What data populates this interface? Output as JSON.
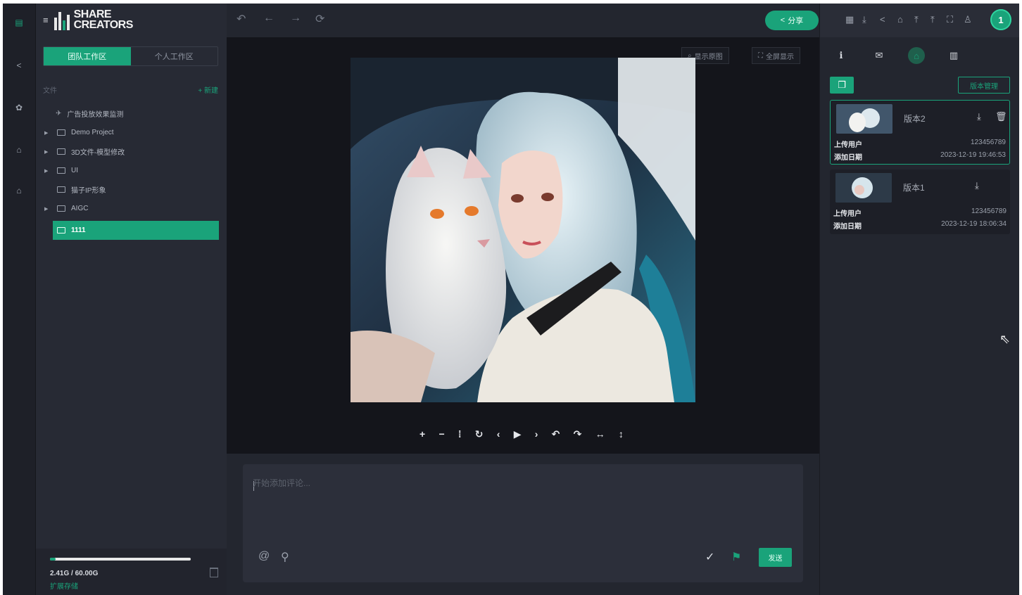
{
  "app": {
    "brand_line1": "SHARE",
    "brand_line2": "CREATORS"
  },
  "workspace_tabs": [
    "团队工作区",
    "个人工作区"
  ],
  "section": {
    "title": "文件",
    "action": "+ 新建"
  },
  "tree": [
    {
      "label": "广告投放效果监测",
      "expandable": false,
      "pinned": true
    },
    {
      "label": "Demo Project",
      "expandable": true
    },
    {
      "label": "3D文件-模型修改",
      "expandable": true
    },
    {
      "label": "UI",
      "expandable": true
    },
    {
      "label": "猫子IP形象",
      "expandable": false
    },
    {
      "label": "AIGC",
      "expandable": true
    },
    {
      "label": "1111",
      "expandable": false,
      "selected": true
    }
  ],
  "storage": {
    "text": "2.41G / 60.00G",
    "link": "扩展存储",
    "used_fraction": 0.04
  },
  "toolbar": {
    "share_label": "分享"
  },
  "viewer": {
    "original_label": "显示原图",
    "fullscreen_label": "全屏显示"
  },
  "comment": {
    "placeholder": "开始添加评论...",
    "send_label": "发送"
  },
  "right": {
    "avatar_initial": "1",
    "version_manage_label": "版本管理",
    "versions": [
      {
        "name": "版本2",
        "uploader_label": "上传用户",
        "uploader": "123456789",
        "date_label": "添加日期",
        "date": "2023-12-19 19:46:53",
        "selected": true
      },
      {
        "name": "版本1",
        "uploader_label": "上传用户",
        "uploader": "123456789",
        "date_label": "添加日期",
        "date": "2023-12-19 18:06:34",
        "selected": false
      }
    ]
  },
  "colors": {
    "accent": "#1aa37a",
    "bg": "#23262f",
    "viewer_bg": "#14151b"
  }
}
